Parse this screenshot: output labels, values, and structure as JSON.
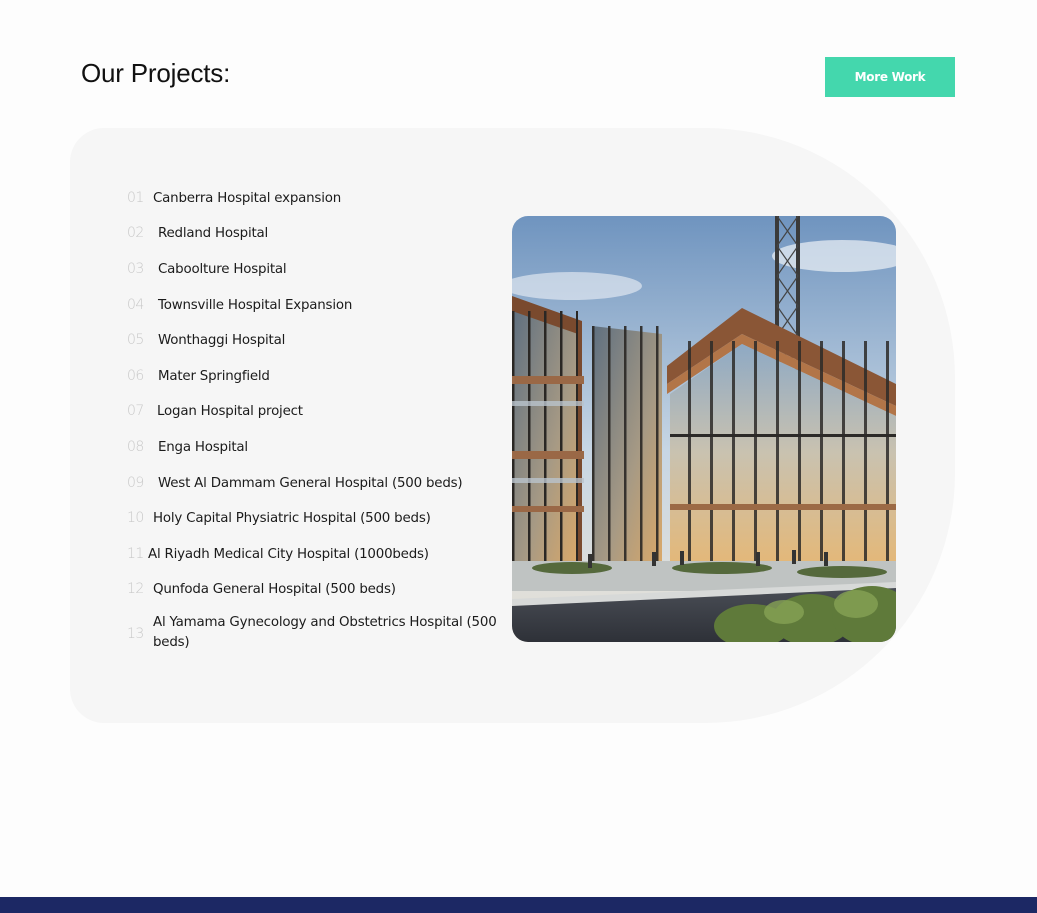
{
  "header": {
    "title": "Our Projects:",
    "more_button": "More Work"
  },
  "projects": [
    {
      "num": "01",
      "name": "Canberra Hospital expansion"
    },
    {
      "num": "02",
      "name": "Redland Hospital"
    },
    {
      "num": "03",
      "name": "Caboolture Hospital"
    },
    {
      "num": "04",
      "name": "Townsville Hospital Expansion"
    },
    {
      "num": "05",
      "name": "Wonthaggi Hospital"
    },
    {
      "num": "06",
      "name": "Mater Springfield"
    },
    {
      "num": "07",
      "name": "Logan Hospital project"
    },
    {
      "num": "08",
      "name": "Enga Hospital"
    },
    {
      "num": "09",
      "name": "West Al Dammam General Hospital (500 beds)"
    },
    {
      "num": "10",
      "name": "Holy Capital Physiatric Hospital (500 beds)"
    },
    {
      "num": "11",
      "name": "Al Riyadh Medical City Hospital (1000beds)"
    },
    {
      "num": "12",
      "name": "Qunfoda General Hospital (500 beds)"
    },
    {
      "num": "13",
      "name": "Al Yamama Gynecology and Obstetrics Hospital (500 beds)"
    }
  ],
  "colors": {
    "accent": "#44d7ad",
    "panel": "#f6f6f6",
    "footer": "#1c2864",
    "number": "#c9c9c9"
  }
}
